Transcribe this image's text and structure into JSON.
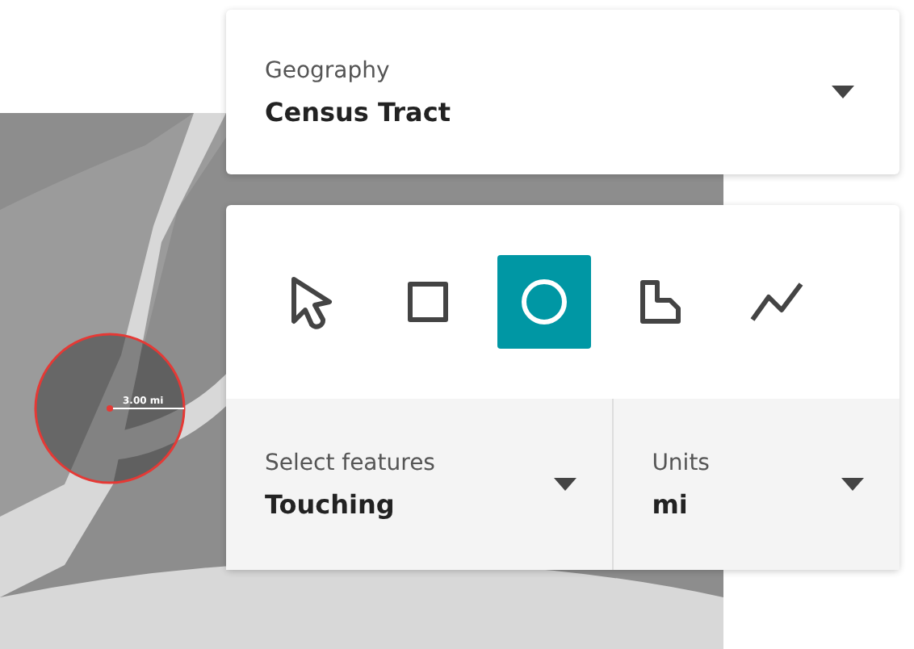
{
  "map": {
    "radius_label": "3.00 mi"
  },
  "geography": {
    "label": "Geography",
    "value": "Census Tract"
  },
  "tools": [
    {
      "kind": "pointer",
      "selected": false
    },
    {
      "kind": "rectangle",
      "selected": false
    },
    {
      "kind": "circle",
      "selected": true
    },
    {
      "kind": "polygon",
      "selected": false
    },
    {
      "kind": "line",
      "selected": false
    }
  ],
  "select_features": {
    "label": "Select features",
    "value": "Touching"
  },
  "units": {
    "label": "Units",
    "value": "mi"
  }
}
